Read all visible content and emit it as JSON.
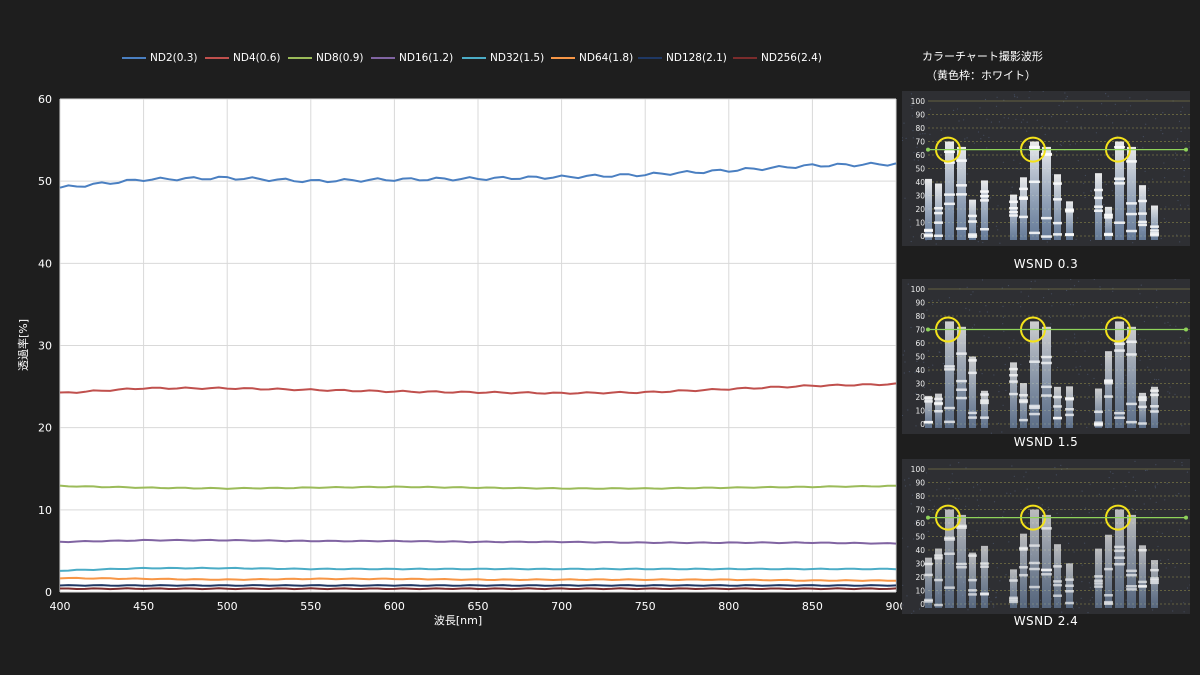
{
  "chart_data": {
    "type": "line",
    "xlabel": "波長[nm]",
    "ylabel": "透過率[%]",
    "xlim": [
      400,
      900
    ],
    "ylim": [
      0,
      60
    ],
    "x_ticks": [
      "400",
      "450",
      "500",
      "550",
      "600",
      "650",
      "700",
      "750",
      "800",
      "850",
      "900"
    ],
    "y_ticks": [
      "0",
      "10",
      "20",
      "30",
      "40",
      "50",
      "60"
    ],
    "grid": true,
    "legend_position": "top",
    "x": [
      400,
      450,
      500,
      550,
      600,
      650,
      700,
      750,
      800,
      850,
      900
    ],
    "series": [
      {
        "name": "ND2(0.3)",
        "color": "#4a7fc1",
        "values": [
          49.2,
          50.2,
          50.4,
          50.0,
          50.2,
          50.3,
          50.5,
          50.8,
          51.3,
          51.9,
          52.1
        ]
      },
      {
        "name": "ND4(0.6)",
        "color": "#c0504d",
        "values": [
          24.2,
          24.8,
          24.8,
          24.6,
          24.4,
          24.3,
          24.2,
          24.3,
          24.7,
          25.1,
          25.3
        ]
      },
      {
        "name": "ND8(0.9)",
        "color": "#9bbb59",
        "values": [
          12.9,
          12.7,
          12.6,
          12.7,
          12.8,
          12.7,
          12.6,
          12.6,
          12.7,
          12.8,
          12.9
        ]
      },
      {
        "name": "ND16(1.2)",
        "color": "#8064a2",
        "values": [
          6.1,
          6.3,
          6.3,
          6.2,
          6.2,
          6.1,
          6.1,
          6.0,
          6.0,
          6.0,
          5.9
        ]
      },
      {
        "name": "ND32(1.5)",
        "color": "#4bacc6",
        "values": [
          2.6,
          2.9,
          2.9,
          2.8,
          2.8,
          2.8,
          2.8,
          2.8,
          2.8,
          2.8,
          2.8
        ]
      },
      {
        "name": "ND64(1.8)",
        "color": "#f79646",
        "values": [
          1.7,
          1.6,
          1.5,
          1.6,
          1.6,
          1.5,
          1.5,
          1.5,
          1.5,
          1.4,
          1.4
        ]
      },
      {
        "name": "ND128(2.1)",
        "color": "#1f3864",
        "values": [
          0.8,
          0.8,
          0.8,
          0.8,
          0.8,
          0.8,
          0.8,
          0.8,
          0.8,
          0.8,
          0.8
        ]
      },
      {
        "name": "ND256(2.4)",
        "color": "#7b2c2c",
        "values": [
          0.4,
          0.4,
          0.4,
          0.4,
          0.4,
          0.4,
          0.4,
          0.4,
          0.4,
          0.4,
          0.4
        ]
      }
    ]
  },
  "side_panel": {
    "heading_line1": "カラーチャート撮影波形",
    "heading_line2": "（黄色枠：ホワイト）",
    "scope_ticks": [
      "100",
      "90",
      "80",
      "70",
      "60",
      "50",
      "40",
      "30",
      "20",
      "10",
      "0"
    ],
    "scopes": [
      {
        "label": "WSND 0.3"
      },
      {
        "label": "WSND 1.5"
      },
      {
        "label": "WSND 2.4"
      }
    ],
    "colors": {
      "highlight_circle": "#f4e21a",
      "marker_line": "#8fd35a",
      "grid_line": "#c9c25a"
    }
  }
}
